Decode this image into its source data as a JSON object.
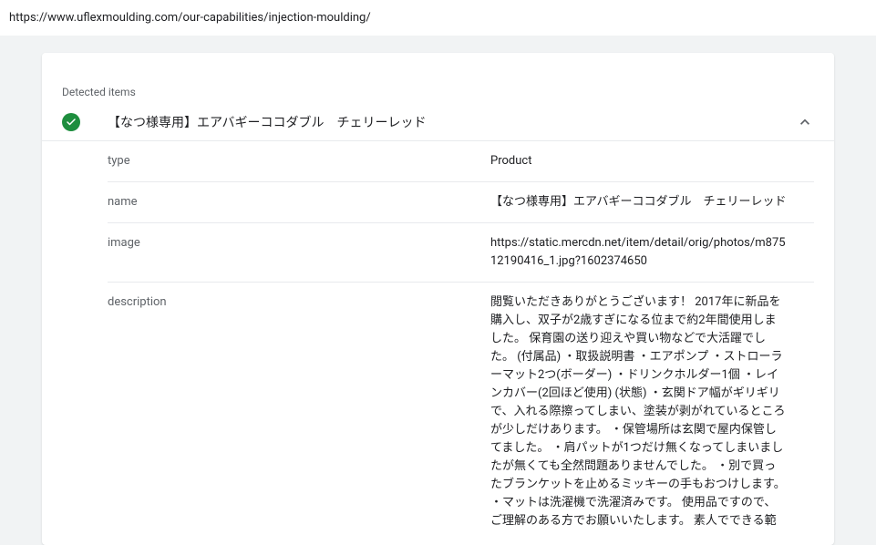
{
  "url": "https://www.uflexmoulding.com/our-capabilities/injection-moulding/",
  "section_label": "Detected items",
  "item": {
    "title": "【なつ様専用】エアバギーココダブル　チェリーレッド",
    "properties": [
      {
        "key": "type",
        "value": "Product"
      },
      {
        "key": "name",
        "value": "【なつ様専用】エアバギーココダブル　チェリーレッド"
      },
      {
        "key": "image",
        "value": "https://static.mercdn.net/item/detail/orig/photos/m87512190416_1.jpg?1602374650"
      },
      {
        "key": "description",
        "value": "閲覧いただきありがとうございます！ 2017年に新品を購入し、双子が2歳すぎになる位まで約2年間使用しました。 保育園の送り迎えや買い物などで大活躍でした。 (付属品) ・取扱説明書 ・エアポンプ ・ストローラーマット2つ(ボーダー) ・ドリンクホルダー1個 ・レインカバー(2回ほど使用) (状態) ・玄関ドア幅がギリギリで、入れる際擦ってしまい、塗装が剥がれているところが少しだけあります。 ・保管場所は玄関で屋内保管してました。 ・肩パットが1つだけ無くなってしまいましたが無くても全然問題ありませんでした。 ・別で買ったブランケットを止めるミッキーの手もおつけします。 ・マットは洗濯機で洗濯済みです。 使用品ですので、ご理解のある方でお願いいたします。 素人でできる範"
      }
    ],
    "key_labels": {
      "type": "type",
      "name": "name",
      "image": "image",
      "description": "description"
    }
  }
}
